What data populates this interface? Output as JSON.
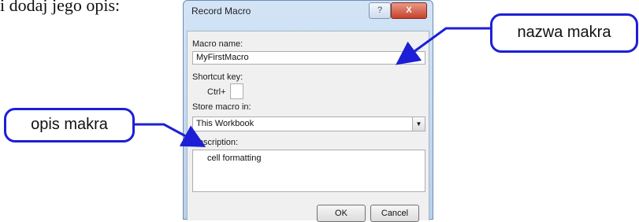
{
  "intro_text": "i dodaj jego opis:",
  "dialog": {
    "title": "Record Macro",
    "help_glyph": "?",
    "close_glyph": "X",
    "macro_name_label": "Macro name:",
    "macro_name_value": "MyFirstMacro",
    "shortcut_label": "Shortcut key:",
    "ctrl_label": "Ctrl+",
    "shortcut_value": "",
    "store_label": "Store macro in:",
    "store_value": "This Workbook",
    "description_label": "Description:",
    "description_value": "cell formatting",
    "ok_label": "OK",
    "cancel_label": "Cancel"
  },
  "callouts": {
    "name_callout": "nazwa makra",
    "desc_callout": "opis makra"
  },
  "colors": {
    "callout_border": "#1d1fd6",
    "arrow": "#1d1fd6",
    "close_button": "#c8412a"
  },
  "icons": {
    "dropdown": "chevron-down-icon",
    "help": "help-icon",
    "close": "close-icon"
  }
}
